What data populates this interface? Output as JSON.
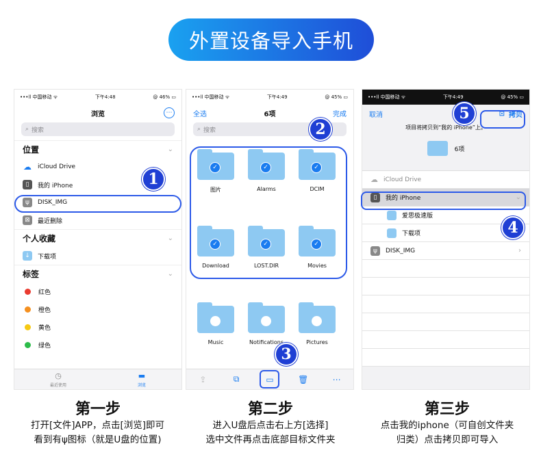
{
  "banner": "外置设备导入手机",
  "p1": {
    "status": {
      "carrier": "•••ll 中国移动 ᯤ",
      "time": "下午4:48",
      "battery": "@ 46% ▭"
    },
    "title": "浏览",
    "more": "⋯",
    "search": "搜索",
    "sec_locations": "位置",
    "locations": [
      "iCloud Drive",
      "我的 iPhone",
      "DISK_IMG",
      "最近删除"
    ],
    "sec_fav": "个人收藏",
    "favorites": [
      "下载项"
    ],
    "sec_tags": "标签",
    "tags": [
      {
        "name": "红色",
        "color": "#ea3b30"
      },
      {
        "name": "橙色",
        "color": "#f5901f"
      },
      {
        "name": "黄色",
        "color": "#f6c913"
      },
      {
        "name": "绿色",
        "color": "#2dbc4a"
      }
    ],
    "tab_recent": "最近使用",
    "tab_browse": "浏览"
  },
  "p2": {
    "status": {
      "carrier": "•••ll 中国移动 ᯤ",
      "time": "下午4:49",
      "battery": "@ 45% ▭"
    },
    "select_all": "全选",
    "title": "6项",
    "done": "完成",
    "search": "搜索",
    "folders": [
      "图片",
      "Alarms",
      "DCIM",
      "Download",
      "LOST.DIR",
      "Movies"
    ],
    "others": [
      "Music",
      "Notifications",
      "Pictures"
    ]
  },
  "p3": {
    "status": {
      "carrier": "•••ll 中国移动 ᯤ",
      "time": "下午4:49",
      "battery": "@ 45% ▭"
    },
    "cancel": "取消",
    "copy": "拷贝",
    "hint": "项目将拷贝到“我的 iPhone”上。",
    "count": "6项",
    "rows": [
      "iCloud Drive",
      "我的 iPhone",
      "爱思极速版",
      "下载项",
      "DISK_IMG"
    ]
  },
  "steps": [
    {
      "title": "第一步",
      "desc1": "打开[文件]APP，点击[浏览]即可",
      "desc2": "看到有ψ图标（就是U盘的位置)"
    },
    {
      "title": "第二步",
      "desc1": "进入U盘后点击右上方[选择]",
      "desc2": "选中文件再点击底部目标文件夹"
    },
    {
      "title": "第三步",
      "desc1": "点击我的iphone（可自创文件夹",
      "desc2": "归类）点击拷贝即可导入"
    }
  ],
  "badges": [
    "1",
    "2",
    "3",
    "4",
    "5"
  ]
}
